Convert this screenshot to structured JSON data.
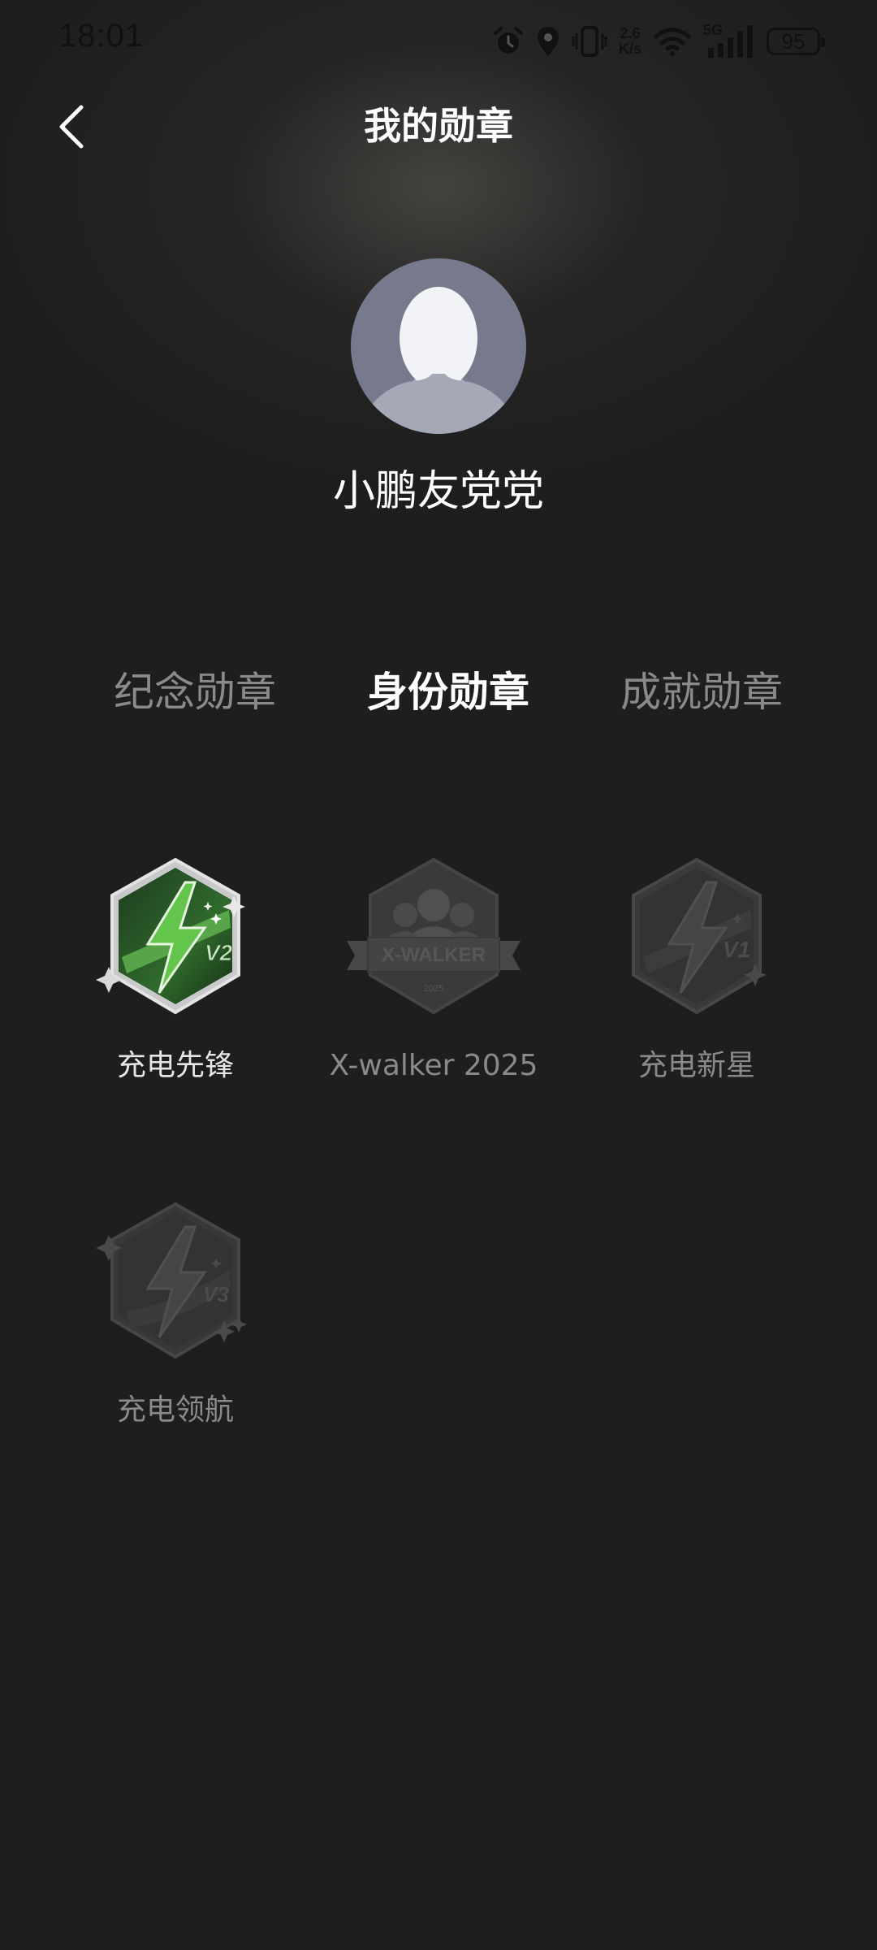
{
  "status_bar": {
    "time": "18:01",
    "net_speed_value": "2.6",
    "net_speed_unit": "K/s",
    "signal_label": "5G",
    "battery": "95"
  },
  "header": {
    "title": "我的勋章"
  },
  "profile": {
    "username": "小鹏友党党"
  },
  "tabs": [
    {
      "label": "纪念勋章",
      "active": false
    },
    {
      "label": "身份勋章",
      "active": true
    },
    {
      "label": "成就勋章",
      "active": false
    }
  ],
  "badges": [
    {
      "label": "充电先锋",
      "earned": true,
      "icon": "lightning-v2-badge-icon",
      "level": "V2"
    },
    {
      "label": "X-walker 2025",
      "earned": false,
      "icon": "xwalker-group-badge-icon",
      "ribbon_text": "X-WALKER",
      "year": "2025"
    },
    {
      "label": "充电新星",
      "earned": false,
      "icon": "lightning-v1-badge-icon",
      "level": "V1"
    },
    {
      "label": "充电领航",
      "earned": false,
      "icon": "lightning-v3-badge-icon",
      "level": "V3"
    }
  ],
  "colors": {
    "background": "#1e1e1e",
    "earned_badge_green": "#3f9e3c",
    "inactive_text": "#8a8a8a"
  }
}
